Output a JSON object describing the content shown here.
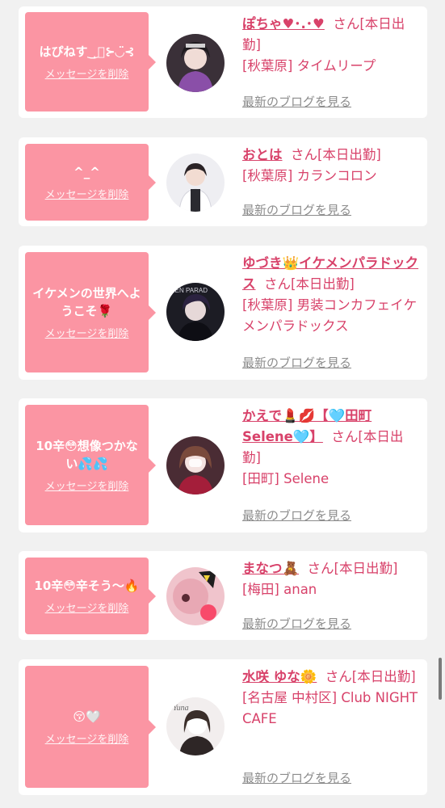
{
  "cards": [
    {
      "message": "はぴねす‿̩͙⊱◡̈⊰",
      "delete_label": "メッセージを削除",
      "name": "ぽちゃ♥･.･♥",
      "honorific": "さん",
      "status": "[本日出勤]",
      "shop": "[秋葉原] タイムリープ",
      "blog_label": "最新のブログを見る"
    },
    {
      "message": "^_^",
      "delete_label": "メッセージを削除",
      "name": "おとは",
      "honorific": "さん",
      "status": "[本日出勤]",
      "shop": "[秋葉原] カランコロン",
      "blog_label": "最新のブログを見る"
    },
    {
      "message": "イケメンの世界へようこそ🌹",
      "delete_label": "メッセージを削除",
      "name": "ゆづき👑イケメンパラドックス",
      "honorific": "さん",
      "status": "[本日出勤]",
      "shop": "[秋葉原] 男装コンカフェイケメンパラドックス",
      "blog_label": "最新のブログを見る"
    },
    {
      "message": "10辛😳想像つかない💦💦",
      "delete_label": "メッセージを削除",
      "name": "かえで💄💋【🩵田町Selene🩵】",
      "honorific": "さん",
      "status": "[本日出勤]",
      "shop": "[田町] Selene",
      "blog_label": "最新のブログを見る"
    },
    {
      "message": "10辛😳辛そう〜🔥",
      "delete_label": "メッセージを削除",
      "name": "まなつ🧸",
      "honorific": "さん",
      "status": "[本日出勤]",
      "shop": "[梅田] anan",
      "blog_label": "最新のブログを見る"
    },
    {
      "message": "😚🤍",
      "delete_label": "メッセージを削除",
      "name": "水咲 ゆな🌼",
      "honorific": "さん",
      "status": "[本日出勤]",
      "shop": "[名古屋 中村区] Club NIGHT CAFE",
      "blog_label": "最新のブログを見る"
    }
  ],
  "avatar_texts": {
    "card3": "MEN PARAD",
    "card6": "Yuna"
  },
  "colors": {
    "page_background": "#f1f1f1",
    "bubble": "#fb95a3",
    "accent_text": "#d8426a",
    "link_gray": "#8c8c8c"
  }
}
